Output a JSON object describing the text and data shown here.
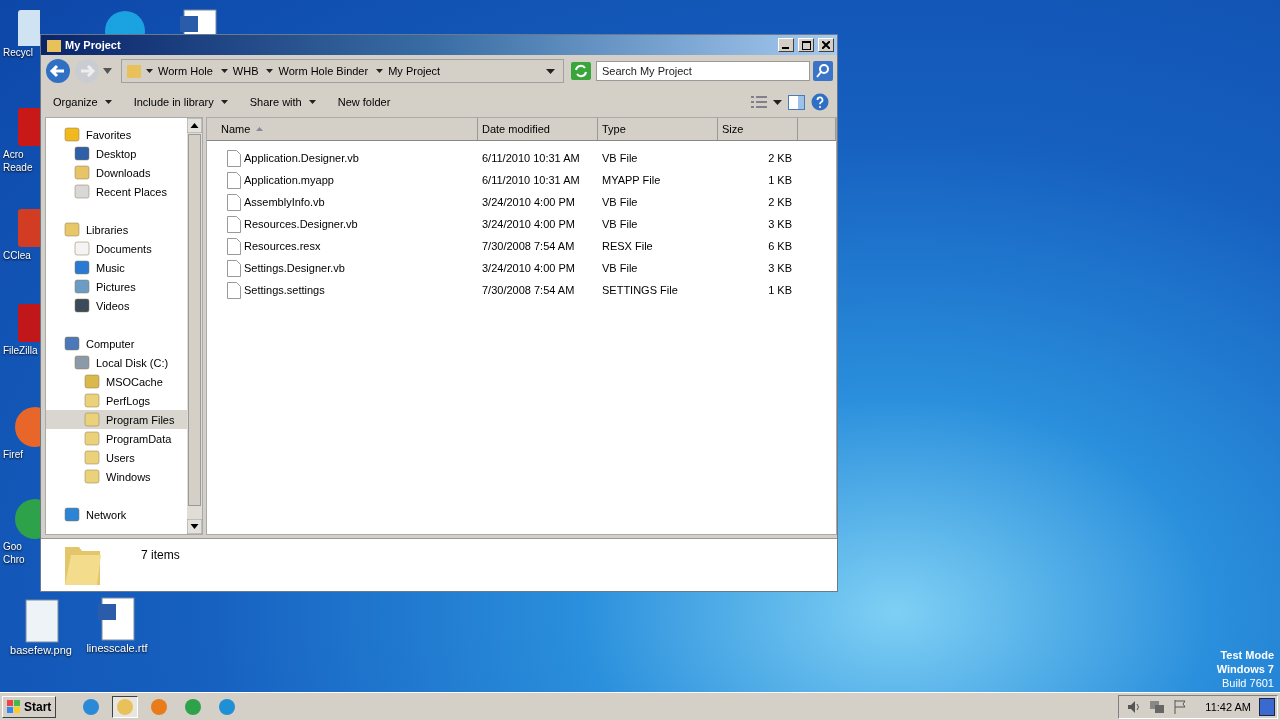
{
  "desktop": {
    "icons": [
      {
        "kind": "recycle",
        "label": [
          "Recycl"
        ]
      },
      {
        "kind": "acrobat",
        "label": [
          "Acro",
          "Reade"
        ]
      },
      {
        "kind": "ccleaner",
        "label": [
          "CClea"
        ]
      },
      {
        "kind": "filezilla",
        "label": [
          "FileZilla"
        ]
      },
      {
        "kind": "firefox",
        "label": [
          "Firef"
        ]
      },
      {
        "kind": "chrome",
        "label": [
          "Goo",
          "Chro"
        ]
      },
      {
        "kind": "image",
        "label": [
          "basefew.png"
        ]
      },
      {
        "kind": "word",
        "label": [
          "linesscale.rtf"
        ]
      },
      {
        "kind": "skype"
      },
      {
        "kind": "word"
      }
    ],
    "mode_text": [
      "Test Mode",
      "Windows 7",
      "Build 7601"
    ]
  },
  "window": {
    "title": "My Project",
    "breadcrumb": [
      "Worm Hole",
      "WHB",
      "Worm Hole Binder",
      "My Project"
    ],
    "search": {
      "placeholder": "Search My Project"
    },
    "toolbar": [
      {
        "label": "Organize",
        "dropdown": true
      },
      {
        "label": "Include in library",
        "dropdown": true
      },
      {
        "label": "Share with",
        "dropdown": true
      },
      {
        "label": "New folder",
        "dropdown": false
      }
    ],
    "nav": [
      {
        "label": "Favorites",
        "kind": "star",
        "selected": false,
        "children": [
          {
            "label": "Desktop",
            "kind": "desktop",
            "selected": false
          },
          {
            "label": "Downloads",
            "kind": "downloads",
            "selected": false
          },
          {
            "label": "Recent Places",
            "kind": "recent",
            "selected": false
          }
        ]
      },
      {
        "label": "Libraries",
        "kind": "library",
        "selected": false,
        "children": [
          {
            "label": "Documents",
            "kind": "document",
            "selected": false
          },
          {
            "label": "Music",
            "kind": "music",
            "selected": false
          },
          {
            "label": "Pictures",
            "kind": "pictures",
            "selected": false
          },
          {
            "label": "Videos",
            "kind": "videos",
            "selected": false
          }
        ]
      },
      {
        "label": "Computer",
        "kind": "computer",
        "selected": false,
        "children": [
          {
            "label": "Local Disk (C:)",
            "kind": "disk",
            "selected": false,
            "children": [
              {
                "label": "MSOCache",
                "kind": "locked-folder",
                "selected": false
              },
              {
                "label": "PerfLogs",
                "kind": "folder",
                "selected": false
              },
              {
                "label": "Program Files",
                "kind": "folder",
                "selected": true
              },
              {
                "label": "ProgramData",
                "kind": "folder",
                "selected": false
              },
              {
                "label": "Users",
                "kind": "folder",
                "selected": false
              },
              {
                "label": "Windows",
                "kind": "folder",
                "selected": false
              }
            ]
          }
        ]
      },
      {
        "label": "Network",
        "kind": "network",
        "selected": false
      }
    ],
    "columns": [
      {
        "label": "Name",
        "sorted": true
      },
      {
        "label": "Date modified",
        "sorted": false
      },
      {
        "label": "Type",
        "sorted": false
      },
      {
        "label": "Size",
        "sorted": false
      }
    ],
    "files": [
      {
        "name": "Application.Designer.vb",
        "date": "6/11/2010 10:31 AM",
        "type": "VB File",
        "size": "2 KB"
      },
      {
        "name": "Application.myapp",
        "date": "6/11/2010 10:31 AM",
        "type": "MYAPP File",
        "size": "1 KB"
      },
      {
        "name": "AssemblyInfo.vb",
        "date": "3/24/2010 4:00 PM",
        "type": "VB File",
        "size": "2 KB"
      },
      {
        "name": "Resources.Designer.vb",
        "date": "3/24/2010 4:00 PM",
        "type": "VB File",
        "size": "3 KB"
      },
      {
        "name": "Resources.resx",
        "date": "7/30/2008 7:54 AM",
        "type": "RESX File",
        "size": "6 KB"
      },
      {
        "name": "Settings.Designer.vb",
        "date": "3/24/2010 4:00 PM",
        "type": "VB File",
        "size": "3 KB"
      },
      {
        "name": "Settings.settings",
        "date": "7/30/2008 7:54 AM",
        "type": "SETTINGS File",
        "size": "1 KB"
      }
    ],
    "status": "7 items"
  },
  "taskbar": {
    "start": "Start",
    "apps": [
      {
        "kind": "ie",
        "selected": false
      },
      {
        "kind": "explorer",
        "selected": true
      },
      {
        "kind": "media",
        "selected": false
      },
      {
        "kind": "chrome",
        "selected": false
      },
      {
        "kind": "edge",
        "selected": false
      }
    ],
    "clock": "11:42 AM"
  }
}
